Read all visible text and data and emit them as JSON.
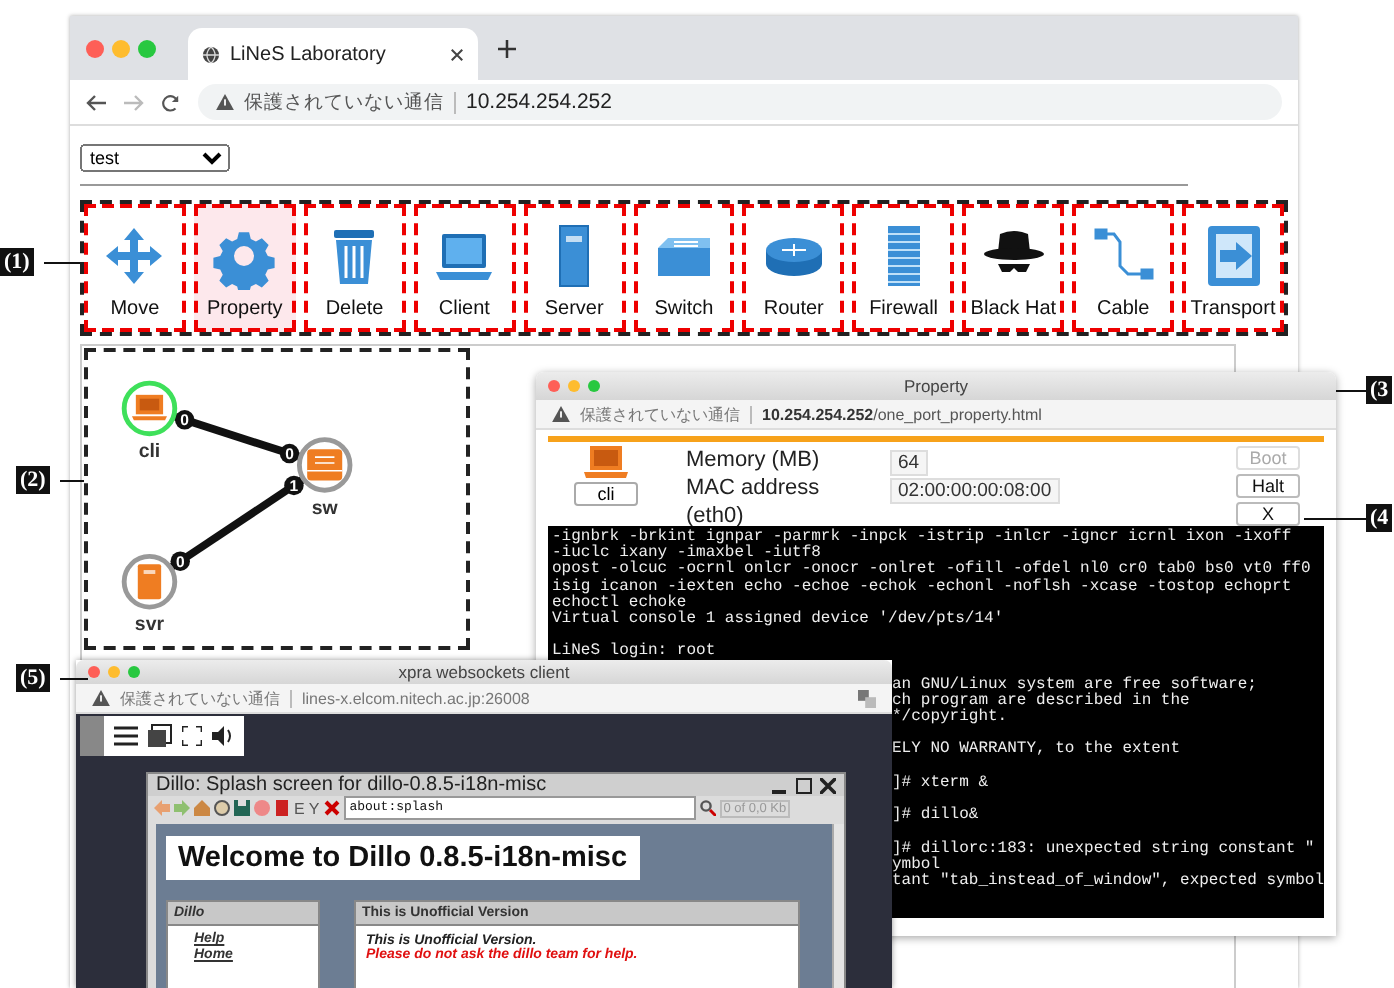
{
  "browser": {
    "tab_title": "LiNeS Laboratory",
    "security": "保護されていない通信",
    "url": "10.254.254.252"
  },
  "topology_select": {
    "value": "test"
  },
  "tools": [
    {
      "kind": "move",
      "label": "Move",
      "selected": false
    },
    {
      "kind": "property",
      "label": "Property",
      "selected": true
    },
    {
      "kind": "delete",
      "label": "Delete",
      "selected": false
    },
    {
      "kind": "client",
      "label": "Client",
      "selected": false
    },
    {
      "kind": "server",
      "label": "Server",
      "selected": false
    },
    {
      "kind": "switch",
      "label": "Switch",
      "selected": false
    },
    {
      "kind": "router",
      "label": "Router",
      "selected": false
    },
    {
      "kind": "firewall",
      "label": "Firewall",
      "selected": false
    },
    {
      "kind": "blackhat",
      "label": "Black Hat",
      "selected": false
    },
    {
      "kind": "cable",
      "label": "Cable",
      "selected": false
    },
    {
      "kind": "transport",
      "label": "Transport",
      "selected": false
    }
  ],
  "diagram": {
    "nodes": [
      {
        "kind": "client",
        "label": "cli",
        "selected": true
      },
      {
        "kind": "switch",
        "label": "sw",
        "selected": false
      },
      {
        "kind": "server",
        "label": "svr",
        "selected": false
      }
    ],
    "links": [
      {
        "from_port": "0",
        "to_port": "0"
      },
      {
        "from_port": "0",
        "to_port": "1"
      }
    ]
  },
  "property_window": {
    "title": "Property",
    "security": "保護されていない通信",
    "url_host": "10.254.254.252",
    "url_path": "/one_port_property.html",
    "node_label": "cli",
    "fields": [
      {
        "label": "Memory (MB)",
        "value": "64"
      },
      {
        "label": "MAC address",
        "value": "02:00:00:00:08:00"
      }
    ],
    "interface": "(eth0)",
    "buttons": [
      {
        "label": "Boot",
        "disabled": true
      },
      {
        "label": "Halt",
        "disabled": false
      },
      {
        "label": "X",
        "disabled": false
      }
    ],
    "terminal": {
      "blocks": [
        [
          "-ignbrk -brkint ignpar -parmrk -inpck -istrip -inlcr -igncr icrnl ixon -ixoff",
          "-iuclc ixany -imaxbel -iutf8",
          "opost -olcuc -ocrnl onlcr -onocr -onlret -ofill -ofdel nl0 cr0 tab0 bs0 vt0 ff0",
          "isig icanon -iexten echo -echoe -echok -echonl -noflsh -xcase -tostop echoprt",
          "echoctl echoke",
          "Virtual console 1 assigned device '/dev/pts/14'"
        ],
        [
          "LiNeS login: root"
        ]
      ],
      "covered_blocks": [
        [
          "an GNU/Linux system are free software;",
          "ch program are described in the",
          "*/copyright."
        ],
        [
          "ELY NO WARRANTY, to the extent"
        ],
        [
          "]# xterm &"
        ],
        [
          "]# dillo&"
        ],
        [
          "]# dillorc:183: unexpected string constant \"",
          "ymbol",
          "tant \"tab_instead_of_window\", expected symbol"
        ]
      ]
    }
  },
  "xpra_window": {
    "title": "xpra websockets client",
    "security": "保護されていない通信",
    "url": "lines-x.elcom.nitech.ac.jp:26008",
    "dillo": {
      "title": "Dillo: Splash screen for dillo-0.8.5-i18n-misc",
      "toolbar_letters": [
        "E",
        "Y"
      ],
      "url": "about:splash",
      "status": "0 of 0,0 Kb",
      "heading": "Welcome to Dillo 0.8.5-i18n-misc",
      "sidebar_title": "Dillo",
      "sidebar_links": [
        "Help",
        "Home"
      ],
      "notice_title": "This is Unofficial Version",
      "notice_lines": [
        {
          "kind": "plain",
          "text": "This is Unofficial Version."
        },
        {
          "kind": "warning",
          "text": "Please do not ask the dillo team for help."
        }
      ]
    }
  },
  "callouts": [
    {
      "label": "(1)"
    },
    {
      "label": "(2)"
    },
    {
      "label": "(3"
    },
    {
      "label": "(4"
    },
    {
      "label": "(5)"
    }
  ]
}
